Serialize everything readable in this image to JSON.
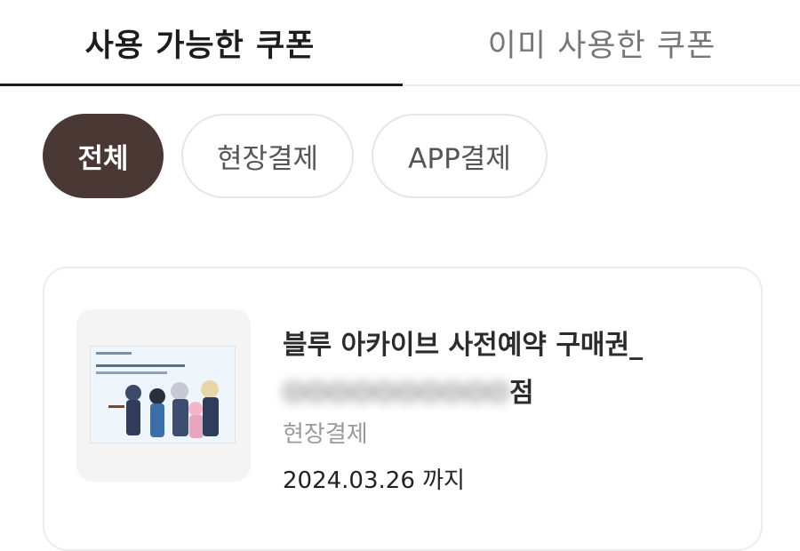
{
  "tabs": {
    "available": "사용 가능한 쿠폰",
    "used": "이미 사용한 쿠폰"
  },
  "filters": {
    "all": "전체",
    "onsite": "현장결제",
    "app": "APP결제"
  },
  "coupon": {
    "title_line1": "블루 아카이브 사전예약 구매권_",
    "title_line2_blurred": "OOOOOOOOOO",
    "title_line2_suffix": "점",
    "payment_type": "현장결제",
    "expiry": "2024.03.26 까지"
  },
  "colors": {
    "accent": "#4a3835",
    "tab_active": "#1c1c1c",
    "muted": "#9a9a9a"
  }
}
